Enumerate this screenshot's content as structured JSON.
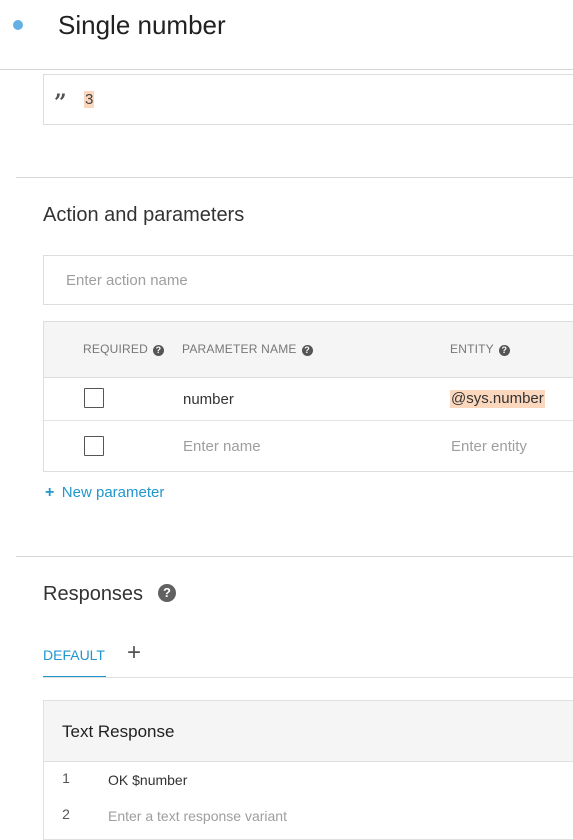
{
  "header": {
    "title": "Single number"
  },
  "training_phrase": {
    "text": "3"
  },
  "action_section": {
    "title": "Action and parameters",
    "action_placeholder": "Enter action name",
    "columns": [
      "REQUIRED",
      "PARAMETER NAME",
      "ENTITY"
    ],
    "help_glyph": "?",
    "rows": [
      {
        "required": false,
        "name": "number",
        "entity": "@sys.number"
      }
    ],
    "new_row": {
      "name_placeholder": "Enter name",
      "entity_placeholder": "Enter entity"
    },
    "add_parameter_icon": "+",
    "add_parameter_label": "New parameter"
  },
  "responses": {
    "title": "Responses",
    "help_glyph": "?",
    "tabs": [
      {
        "label": "DEFAULT",
        "active": true
      }
    ],
    "add_tab_icon": "+",
    "card_title": "Text Response",
    "lines": [
      {
        "num": "1",
        "text": "OK $number"
      },
      {
        "num": "2",
        "placeholder": "Enter a text response variant"
      }
    ]
  },
  "colors": {
    "accent": "#2196cf",
    "highlight": "#fbd7bd",
    "status_dot": "#64b0e4"
  }
}
